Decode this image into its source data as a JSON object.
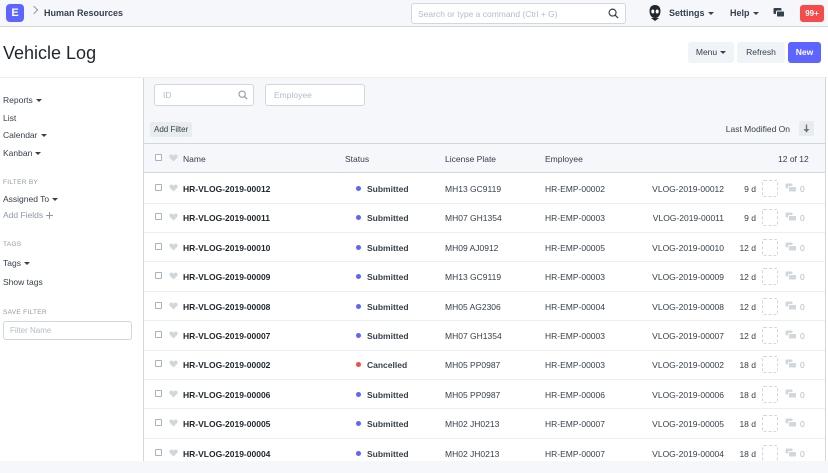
{
  "navbar": {
    "logo_letter": "E",
    "breadcrumb": "Human Resources",
    "search_placeholder": "Search or type a command (Ctrl + G)",
    "settings_label": "Settings",
    "help_label": "Help",
    "notifications_badge": "99+"
  },
  "page": {
    "title": "Vehicle Log",
    "menu_label": "Menu",
    "refresh_label": "Refresh",
    "new_label": "New"
  },
  "sidebar": {
    "reports": "Reports",
    "list": "List",
    "calendar": "Calendar",
    "kanban": "Kanban",
    "filter_by": "FILTER BY",
    "assigned_to": "Assigned To",
    "add_fields": "Add Fields",
    "tags_heading": "TAGS",
    "tags": "Tags",
    "show_tags": "Show tags",
    "save_filter_heading": "SAVE FILTER",
    "filter_name_placeholder": "Filter Name"
  },
  "filters": {
    "id_placeholder": "ID",
    "employee_placeholder": "Employee",
    "add_filter": "Add Filter",
    "sort_label": "Last Modified On"
  },
  "list": {
    "columns": {
      "name": "Name",
      "status": "Status",
      "license_plate": "License Plate",
      "employee": "Employee"
    },
    "count": "12 of 12",
    "status_colors": {
      "Submitted": "#5e64ff",
      "Cancelled": "#f74b4b"
    },
    "rows": [
      {
        "name": "HR-VLOG-2019-00012",
        "status": "Submitted",
        "plate": "MH13 GC9119",
        "employee": "HR-EMP-00002",
        "ref": "VLOG-2019-00012",
        "age": "9 d",
        "comments": "0"
      },
      {
        "name": "HR-VLOG-2019-00011",
        "status": "Submitted",
        "plate": "MH07 GH1354",
        "employee": "HR-EMP-00003",
        "ref": "VLOG-2019-00011",
        "age": "9 d",
        "comments": "0"
      },
      {
        "name": "HR-VLOG-2019-00010",
        "status": "Submitted",
        "plate": "MH09 AJ0912",
        "employee": "HR-EMP-00005",
        "ref": "VLOG-2019-00010",
        "age": "12 d",
        "comments": "0"
      },
      {
        "name": "HR-VLOG-2019-00009",
        "status": "Submitted",
        "plate": "MH13 GC9119",
        "employee": "HR-EMP-00003",
        "ref": "VLOG-2019-00009",
        "age": "12 d",
        "comments": "0"
      },
      {
        "name": "HR-VLOG-2019-00008",
        "status": "Submitted",
        "plate": "MH05 AG2306",
        "employee": "HR-EMP-00004",
        "ref": "VLOG-2019-00008",
        "age": "12 d",
        "comments": "0"
      },
      {
        "name": "HR-VLOG-2019-00007",
        "status": "Submitted",
        "plate": "MH07 GH1354",
        "employee": "HR-EMP-00003",
        "ref": "VLOG-2019-00007",
        "age": "12 d",
        "comments": "0"
      },
      {
        "name": "HR-VLOG-2019-00002",
        "status": "Cancelled",
        "plate": "MH05 PP0987",
        "employee": "HR-EMP-00003",
        "ref": "VLOG-2019-00002",
        "age": "18 d",
        "comments": "0"
      },
      {
        "name": "HR-VLOG-2019-00006",
        "status": "Submitted",
        "plate": "MH05 PP0987",
        "employee": "HR-EMP-00006",
        "ref": "VLOG-2019-00006",
        "age": "18 d",
        "comments": "0"
      },
      {
        "name": "HR-VLOG-2019-00005",
        "status": "Submitted",
        "plate": "MH02 JH0213",
        "employee": "HR-EMP-00007",
        "ref": "VLOG-2019-00005",
        "age": "18 d",
        "comments": "0"
      },
      {
        "name": "HR-VLOG-2019-00004",
        "status": "Submitted",
        "plate": "MH02 JH0213",
        "employee": "HR-EMP-00007",
        "ref": "VLOG-2019-00004",
        "age": "18 d",
        "comments": "0"
      }
    ]
  }
}
